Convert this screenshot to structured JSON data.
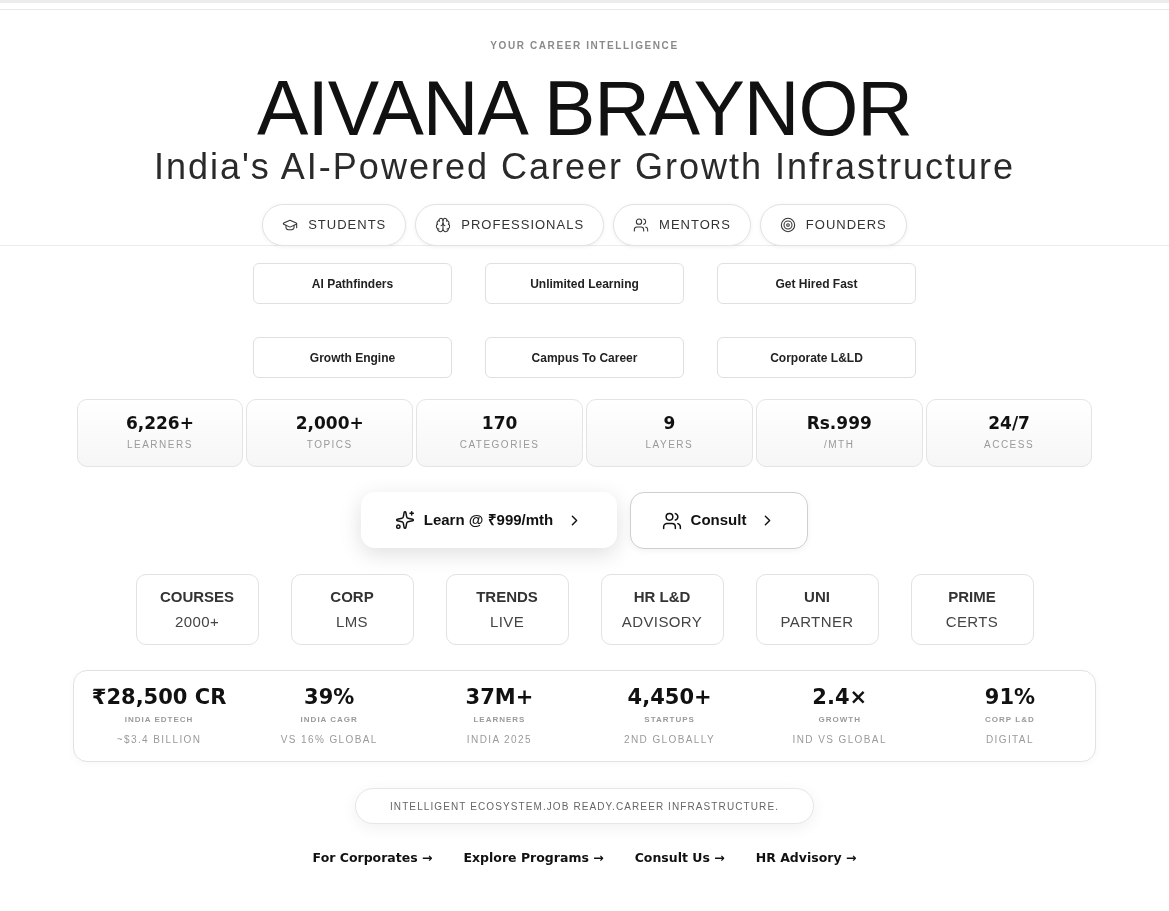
{
  "hero": {
    "eyebrow": "YOUR CAREER INTELLIGENCE",
    "title": "AIVANA BRAYNOR",
    "subtitle": "India's AI-Powered Career Growth Infrastructure"
  },
  "audiences": [
    {
      "label": "STUDENTS"
    },
    {
      "label": "PROFESSIONALS"
    },
    {
      "label": "MENTORS"
    },
    {
      "label": "FOUNDERS"
    }
  ],
  "features": [
    "AI Pathfinders",
    "Unlimited Learning",
    "Get Hired Fast",
    "Growth Engine",
    "Campus To Career",
    "Corporate L&LD"
  ],
  "stats": [
    {
      "value": "6,226+",
      "label": "LEARNERS"
    },
    {
      "value": "2,000+",
      "label": "TOPICS"
    },
    {
      "value": "170",
      "label": "CATEGORIES"
    },
    {
      "value": "9",
      "label": "LAYERS"
    },
    {
      "value": "Rs.999",
      "label": "/MTH"
    },
    {
      "value": "24/7",
      "label": "ACCESS"
    }
  ],
  "cta": [
    {
      "label": "Learn @ ₹999/mth",
      "kind": "primary"
    },
    {
      "label": "Consult",
      "kind": "secondary"
    }
  ],
  "tiles": [
    {
      "title": "COURSES",
      "subtitle": "2000+"
    },
    {
      "title": "CORP",
      "subtitle": "LMS"
    },
    {
      "title": "TRENDS",
      "subtitle": "LIVE"
    },
    {
      "title": "HR L&D",
      "subtitle": "ADVISORY"
    },
    {
      "title": "UNI",
      "subtitle": "PARTNER"
    },
    {
      "title": "PRIME",
      "subtitle": "CERTS"
    }
  ],
  "market": [
    {
      "value": "₹28,500 CR",
      "label": "INDIA EDTECH",
      "note": "~$3.4 BILLION"
    },
    {
      "value": "39%",
      "label": "INDIA CAGR",
      "note": "VS 16% GLOBAL"
    },
    {
      "value": "37M+",
      "label": "LEARNERS",
      "note": "INDIA 2025"
    },
    {
      "value": "4,450+",
      "label": "STARTUPS",
      "note": "2ND GLOBALLY"
    },
    {
      "value": "2.4×",
      "label": "GROWTH",
      "note": "IND VS GLOBAL"
    },
    {
      "value": "91%",
      "label": "CORP L&D",
      "note": "DIGITAL"
    }
  ],
  "tagline": "INTELLIGENT ECOSYSTEM.JOB READY.CAREER INFRASTRUCTURE.",
  "links": [
    "For Corporates →",
    "Explore Programs →",
    "Consult Us →",
    "HR Advisory →"
  ]
}
